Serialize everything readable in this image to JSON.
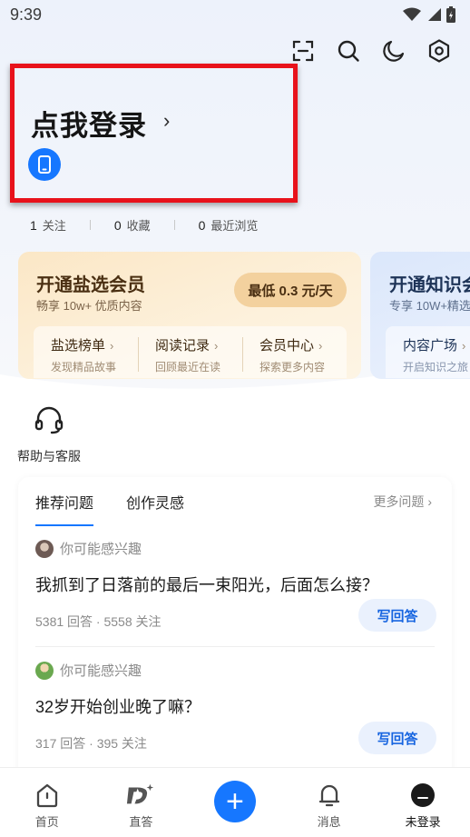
{
  "status_bar": {
    "time": "9:39"
  },
  "top_icons": [
    "scan-icon",
    "search-icon",
    "theme-icon",
    "settings-icon"
  ],
  "login": {
    "title": "点我登录",
    "chevron": "›"
  },
  "stats": [
    {
      "num": "1",
      "label": "关注"
    },
    {
      "num": "0",
      "label": "收藏"
    },
    {
      "num": "0",
      "label": "最近浏览"
    }
  ],
  "salt_card": {
    "title": "开通盐选会员",
    "subtitle": "畅享 10w+ 优质内容",
    "price": "最低 0.3 元/天",
    "items": [
      {
        "label": "盐选榜单",
        "desc": "发现精品故事"
      },
      {
        "label": "阅读记录",
        "desc": "回顾最近在读"
      },
      {
        "label": "会员中心",
        "desc": "探索更多内容"
      }
    ]
  },
  "knowledge_card": {
    "title": "开通知识会",
    "subtitle": "专享 10W+精选",
    "item": {
      "label": "内容广场",
      "desc": "开启知识之旅"
    }
  },
  "help": {
    "label": "帮助与客服"
  },
  "questions": {
    "tabs": [
      "推荐问题",
      "创作灵感"
    ],
    "more": "更多问题 ›",
    "items": [
      {
        "reason": "你可能感兴趣",
        "title": "我抓到了日落前的最后一束阳光，后面怎么接？",
        "stats": "5381 回答 · 5558 关注",
        "button": "写回答"
      },
      {
        "reason": "你可能感兴趣",
        "title": "32岁开始创业晚了嘛？",
        "stats": "317 回答 · 395 关注",
        "button": "写回答"
      }
    ]
  },
  "nav": {
    "items": [
      {
        "label": "首页",
        "icon": "home-icon"
      },
      {
        "label": "直答",
        "icon": "direct-answer-icon"
      },
      {
        "label": "",
        "icon": "plus-icon"
      },
      {
        "label": "消息",
        "icon": "bell-icon"
      },
      {
        "label": "未登录",
        "icon": "avatar-icon"
      }
    ]
  },
  "colors": {
    "accent": "#1677ff",
    "highlight_border": "#e8121b",
    "salt_card": "#fbe7c6",
    "knowledge_card": "#dbe7fb"
  }
}
